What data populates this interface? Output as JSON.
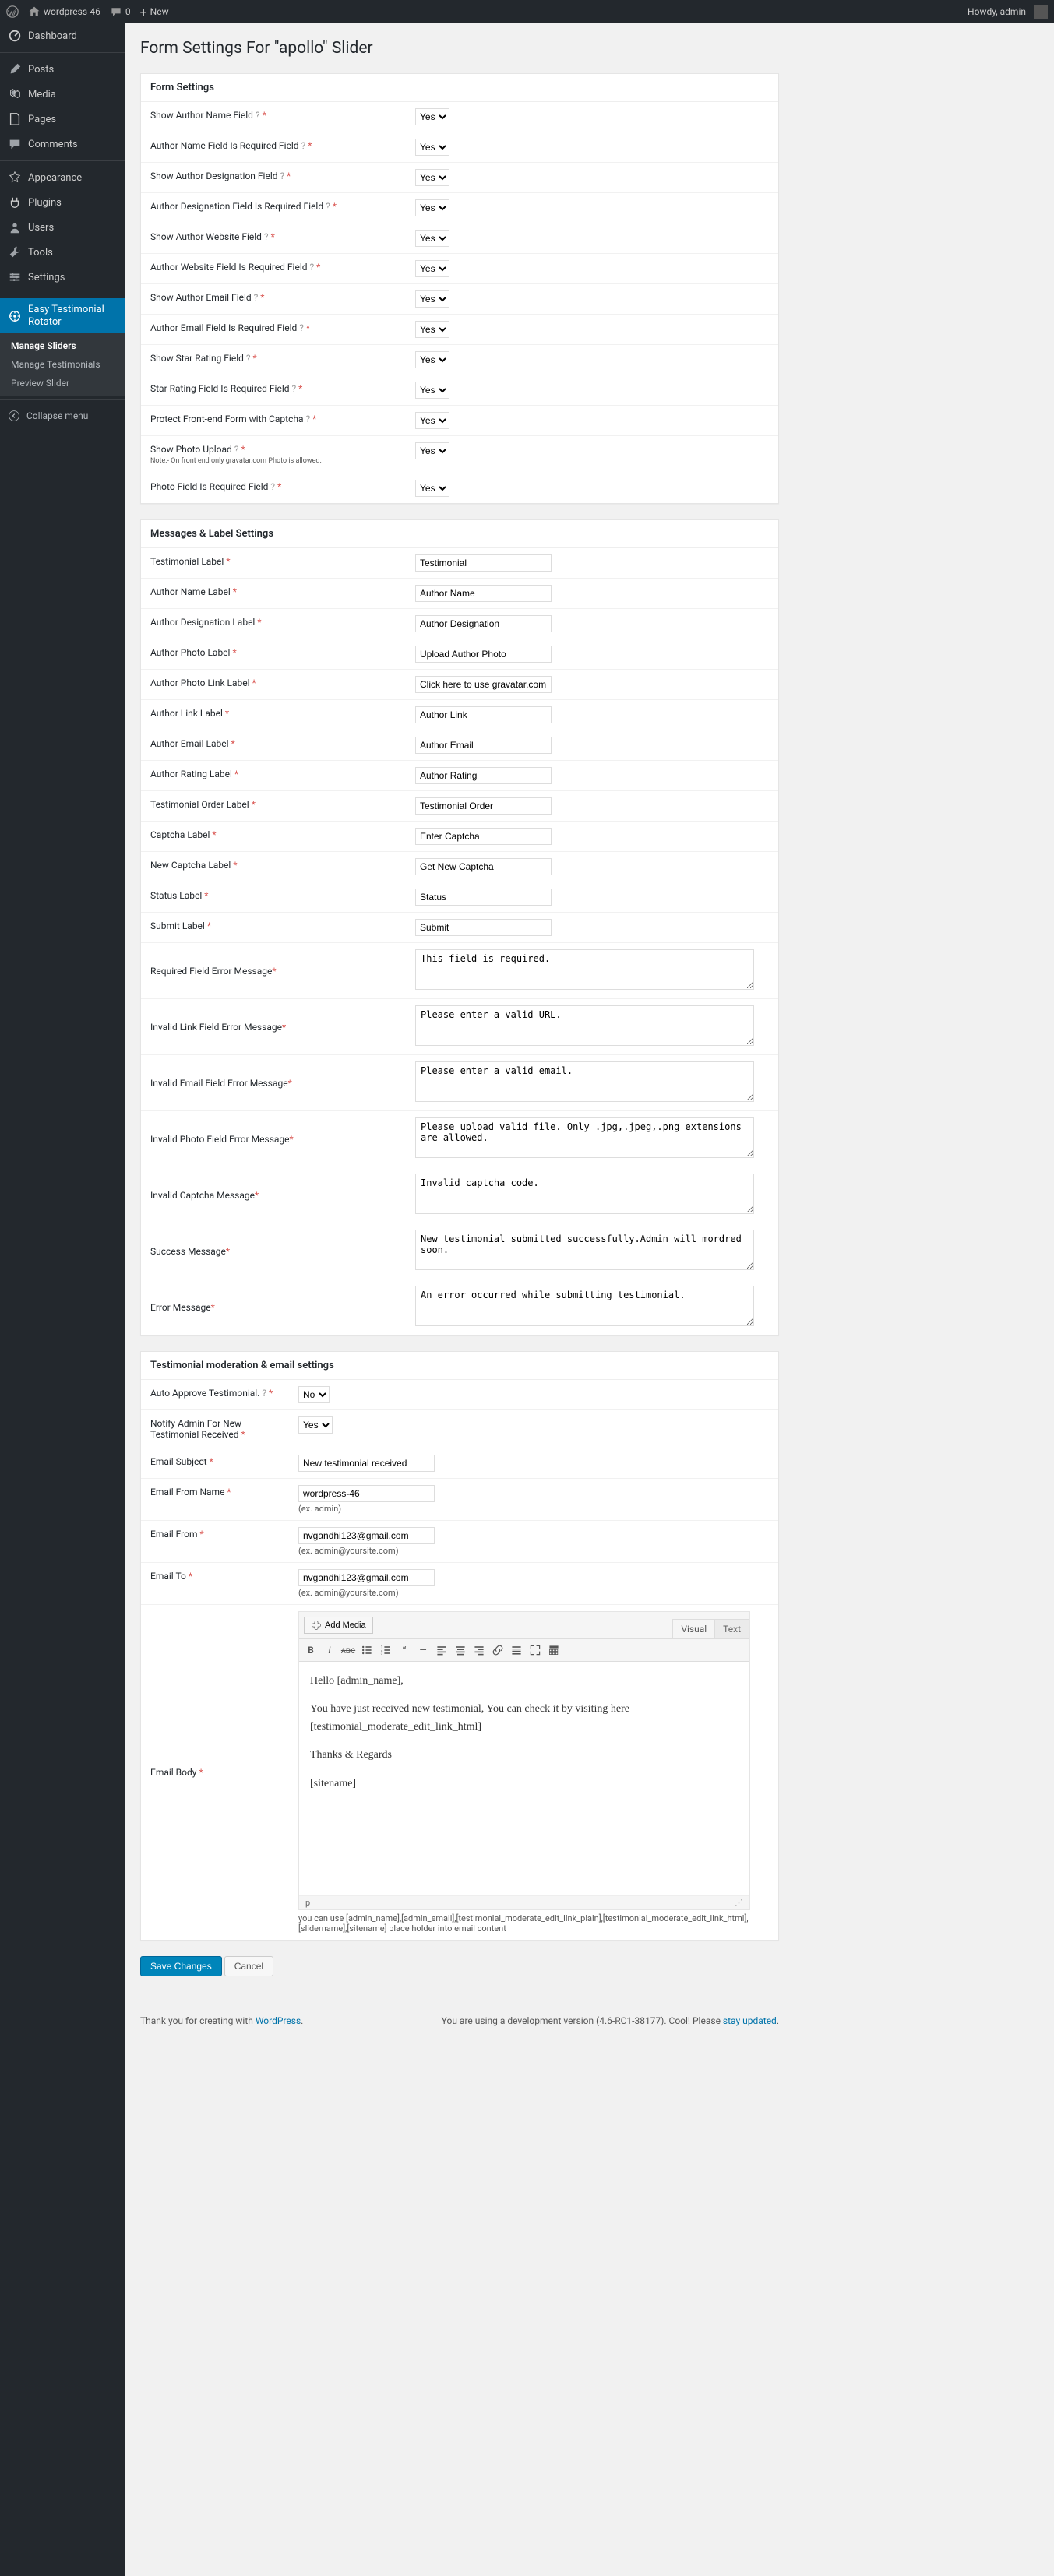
{
  "adminbar": {
    "site_name": "wordpress-46",
    "comments": "0",
    "new_label": "New",
    "howdy": "Howdy, admin"
  },
  "menu": {
    "dashboard": "Dashboard",
    "posts": "Posts",
    "media": "Media",
    "pages": "Pages",
    "comments": "Comments",
    "appearance": "Appearance",
    "plugins": "Plugins",
    "users": "Users",
    "tools": "Tools",
    "settings": "Settings",
    "rotator": "Easy Testimonial Rotator",
    "sub_manage_sliders": "Manage Sliders",
    "sub_manage_testimonials": "Manage Testimonials",
    "sub_preview": "Preview Slider",
    "collapse": "Collapse menu"
  },
  "page_title": "Form Settings For \"apollo\" Slider",
  "yes": "Yes",
  "no": "No",
  "form_settings": {
    "heading": "Form Settings",
    "rows": {
      "show_author_name": "Show Author Name Field",
      "author_name_required": "Author Name Field Is Required Field",
      "show_designation": "Show Author Designation Field",
      "designation_required": "Author Designation Field Is Required Field",
      "show_website": "Show Author Website Field",
      "website_required": "Author Website Field Is Required Field",
      "show_email": "Show Author Email Field",
      "email_required": "Author Email Field Is Required Field",
      "show_star": "Show Star Rating Field",
      "star_required": "Star Rating Field Is Required Field",
      "protect_captcha": "Protect Front-end Form with Captcha",
      "show_photo": "Show Photo Upload",
      "photo_note": "Note:- On front end only gravatar.com Photo is allowed.",
      "photo_required": "Photo Field Is Required Field"
    }
  },
  "labels": {
    "heading": "Messages & Label Settings",
    "rows": [
      {
        "k": "testimonial_label",
        "label": "Testimonial Label",
        "value": "Testimonial"
      },
      {
        "k": "author_name_label",
        "label": "Author Name Label",
        "value": "Author Name"
      },
      {
        "k": "author_designation_label",
        "label": "Author Designation Label",
        "value": "Author Designation"
      },
      {
        "k": "author_photo_label",
        "label": "Author Photo Label",
        "value": "Upload Author Photo"
      },
      {
        "k": "author_photo_link_label",
        "label": "Author Photo Link Label",
        "value": "Click here to use gravatar.com photo"
      },
      {
        "k": "author_link_label",
        "label": "Author Link Label",
        "value": "Author Link"
      },
      {
        "k": "author_email_label",
        "label": "Author Email Label",
        "value": "Author Email"
      },
      {
        "k": "author_rating_label",
        "label": "Author Rating Label",
        "value": "Author Rating"
      },
      {
        "k": "testimonial_order_label",
        "label": "Testimonial Order Label",
        "value": "Testimonial Order"
      },
      {
        "k": "captcha_label",
        "label": "Captcha Label",
        "value": "Enter Captcha"
      },
      {
        "k": "new_captcha_label",
        "label": "New Captcha Label",
        "value": "Get New Captcha"
      },
      {
        "k": "status_label",
        "label": "Status Label",
        "value": "Status"
      },
      {
        "k": "submit_label",
        "label": "Submit Label",
        "value": "Submit"
      }
    ],
    "textareas": [
      {
        "k": "required_err",
        "label": "Required Field Error Message",
        "value": "This field is required."
      },
      {
        "k": "invalid_link",
        "label": "Invalid Link Field Error Message",
        "value": "Please enter a valid URL."
      },
      {
        "k": "invalid_email",
        "label": "Invalid Email Field Error Message",
        "value": "Please enter a valid email."
      },
      {
        "k": "invalid_photo",
        "label": "Invalid Photo Field Error Message",
        "value": "Please upload valid file. Only .jpg,.jpeg,.png extensions are allowed."
      },
      {
        "k": "invalid_captcha",
        "label": "Invalid Captcha Message",
        "value": "Invalid captcha code."
      },
      {
        "k": "success_msg",
        "label": "Success Message",
        "value": "New testimonial submitted successfully.Admin will mordred soon."
      },
      {
        "k": "error_msg",
        "label": "Error Message",
        "value": "An error occurred while submitting testimonial."
      }
    ]
  },
  "moderation": {
    "heading": "Testimonial moderation & email settings",
    "auto_approve": "Auto Approve Testimonial.",
    "auto_approve_val": "No",
    "notify_admin": "Notify Admin For New Testimonial Received",
    "notify_admin_val": "Yes",
    "email_subject_label": "Email Subject",
    "email_subject_val": "New testimonial received",
    "email_from_name_label": "Email From Name",
    "email_from_name_val": "wordpress-46",
    "email_from_name_hint": "(ex. admin)",
    "email_from_label": "Email From",
    "email_from_val": "nvgandhi123@gmail.com",
    "email_from_hint": "(ex. admin@yoursite.com)",
    "email_to_label": "Email To",
    "email_to_val": "nvgandhi123@gmail.com",
    "email_to_hint": "(ex. admin@yoursite.com)",
    "email_body_label": "Email Body",
    "add_media": "Add Media",
    "tab_visual": "Visual",
    "tab_text": "Text",
    "editor_greeting": "Hello [admin_name],",
    "editor_line1": "You have just received new testimonial, You can check it by visiting here [testimonial_moderate_edit_link_html]",
    "editor_thanks": "Thanks & Regards",
    "editor_sitename": "[sitename]",
    "editor_path": "p",
    "editor_hint": "you can use [admin_name],[admin_email],[testimonial_moderate_edit_link_plain],[testimonial_moderate_edit_link_html],[slidername],[sitename] place holder into email content"
  },
  "buttons": {
    "save": "Save Changes",
    "cancel": "Cancel"
  },
  "footer": {
    "left_a": "Thank you for creating with ",
    "left_b": "WordPress",
    "right_a": "You are using a development version (4.6-RC1-38177). Cool! Please ",
    "right_b": "stay updated"
  }
}
